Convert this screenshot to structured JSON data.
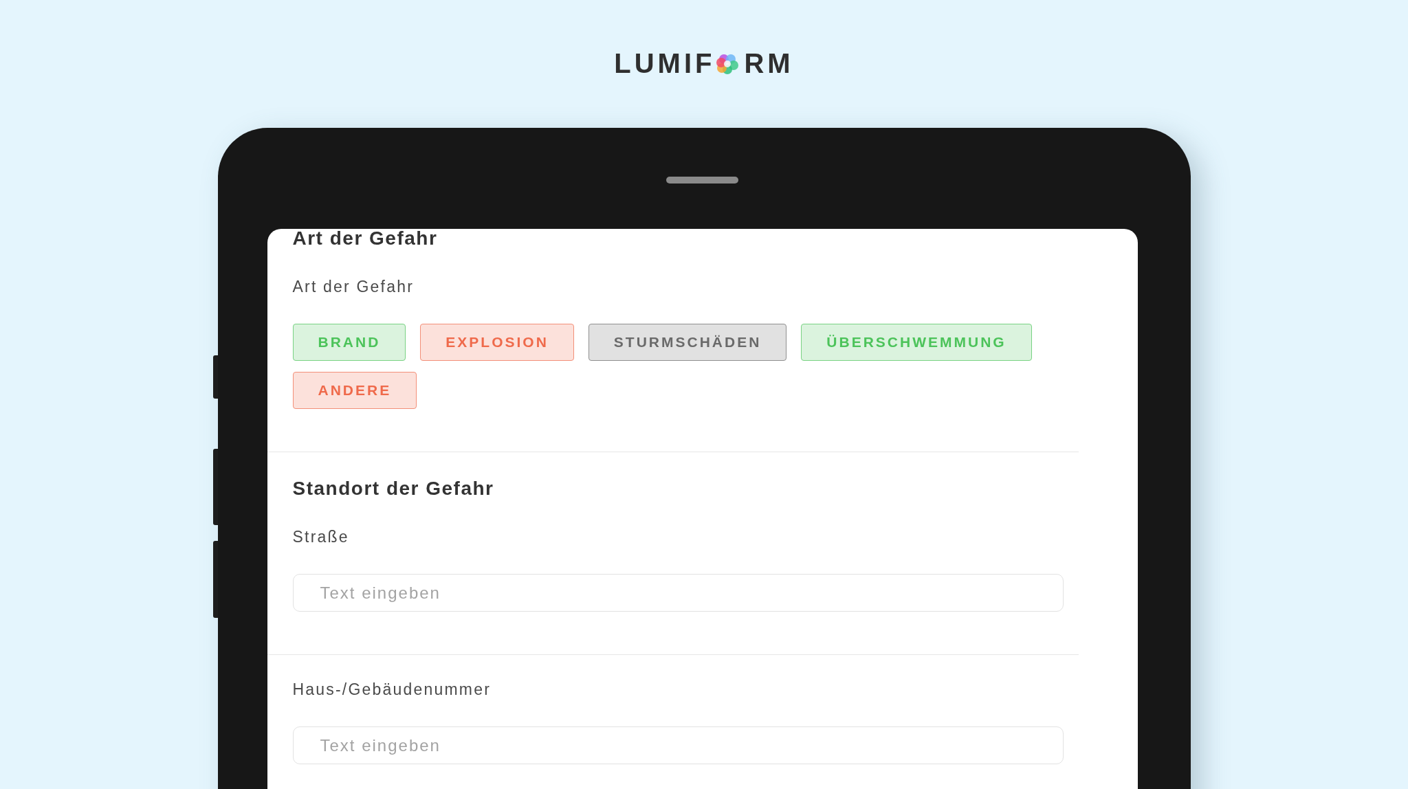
{
  "logo": {
    "text_left": "LUMIF",
    "text_right": "RM"
  },
  "form": {
    "sections": [
      {
        "title": "Art der Gefahr",
        "fields": [
          {
            "kind": "chips",
            "label": "Art der Gefahr",
            "options": [
              {
                "label": "BRAND",
                "color": "#4cc35a"
              },
              {
                "label": "EXPLOSION",
                "color": "#ef6a4b"
              },
              {
                "label": "STURMSCHÄDEN",
                "color": "#6a6a6a"
              },
              {
                "label": "ÜBERSCHWEMMUNG",
                "color": "#4cc35a"
              },
              {
                "label": "ANDERE",
                "color": "#ef6a4b"
              }
            ]
          }
        ]
      },
      {
        "title": "Standort der Gefahr",
        "fields": [
          {
            "kind": "text",
            "label": "Straße",
            "placeholder": "Text eingeben"
          }
        ]
      },
      {
        "fields": [
          {
            "kind": "text",
            "label": "Haus-/Gebäudenummer",
            "placeholder": "Text eingeben"
          }
        ]
      }
    ]
  }
}
